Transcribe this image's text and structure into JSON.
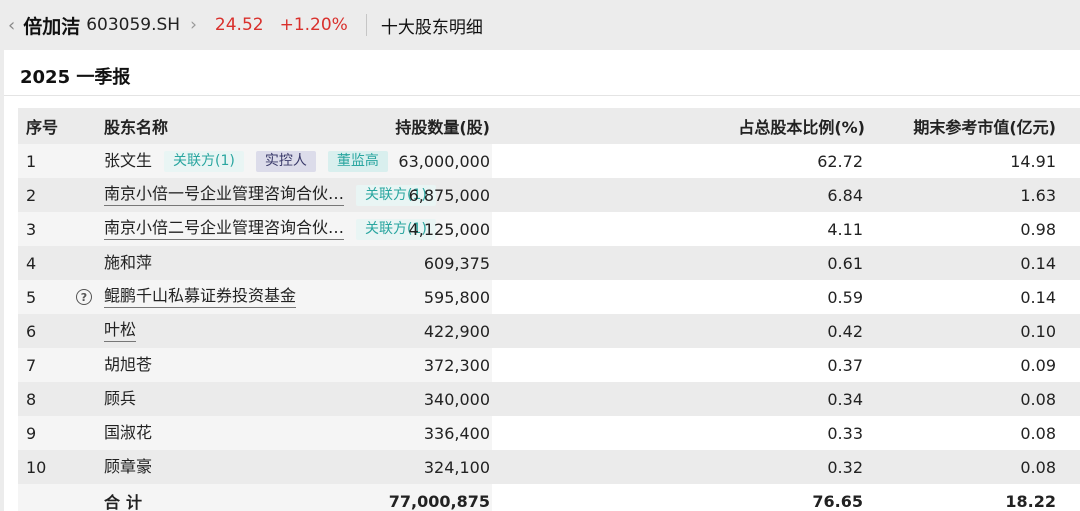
{
  "header": {
    "back_icon": "chevron-left-icon",
    "stock_name": "倍加洁",
    "stock_code": "603059.SH",
    "chevron_icon": "chevron-right-icon",
    "price": "24.52",
    "change_pct": "+1.20%",
    "page_title": "十大股东明细",
    "accent_up_color": "#d9302c"
  },
  "period": "2025 一季报",
  "table": {
    "columns": [
      "序号",
      "股东名称",
      "持股数量(股)",
      "占总股本比例(%)",
      "期末参考市值(亿元)"
    ],
    "rows": [
      {
        "no": "1",
        "name": "张文生",
        "underline": false,
        "tags": [
          {
            "text": "关联方(1)",
            "kind": "rel"
          },
          {
            "text": "实控人",
            "kind": "ctl"
          },
          {
            "text": "董监高",
            "kind": "exec"
          }
        ],
        "shares": "63,000,000",
        "ratio": "62.72",
        "value": "14.91"
      },
      {
        "no": "2",
        "name": "南京小倍一号企业管理咨询合伙…",
        "underline": true,
        "tags": [
          {
            "text": "关联方(1)",
            "kind": "rel"
          }
        ],
        "shares": "6,875,000",
        "ratio": "6.84",
        "value": "1.63"
      },
      {
        "no": "3",
        "name": "南京小倍二号企业管理咨询合伙…",
        "underline": true,
        "tags": [
          {
            "text": "关联方(1)",
            "kind": "rel"
          }
        ],
        "shares": "4,125,000",
        "ratio": "4.11",
        "value": "0.98"
      },
      {
        "no": "4",
        "name": "施和萍",
        "underline": false,
        "tags": [],
        "shares": "609,375",
        "ratio": "0.61",
        "value": "0.14"
      },
      {
        "no": "5",
        "name": "鲲鹏千山私募证券投资基金",
        "underline": true,
        "help": "?",
        "tags": [],
        "shares": "595,800",
        "ratio": "0.59",
        "value": "0.14"
      },
      {
        "no": "6",
        "name": "叶松",
        "underline": true,
        "tags": [],
        "shares": "422,900",
        "ratio": "0.42",
        "value": "0.10"
      },
      {
        "no": "7",
        "name": "胡旭苍",
        "underline": false,
        "tags": [],
        "shares": "372,300",
        "ratio": "0.37",
        "value": "0.09"
      },
      {
        "no": "8",
        "name": "顾兵",
        "underline": false,
        "tags": [],
        "shares": "340,000",
        "ratio": "0.34",
        "value": "0.08"
      },
      {
        "no": "9",
        "name": "国淑花",
        "underline": false,
        "tags": [],
        "shares": "336,400",
        "ratio": "0.33",
        "value": "0.08"
      },
      {
        "no": "10",
        "name": "顾章豪",
        "underline": false,
        "tags": [],
        "shares": "324,100",
        "ratio": "0.32",
        "value": "0.08"
      }
    ],
    "total": {
      "label": "合计",
      "shares": "77,000,875",
      "ratio": "76.65",
      "value": "18.22"
    }
  }
}
